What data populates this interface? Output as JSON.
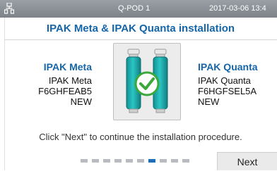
{
  "topbar": {
    "device_name": "Q-POD 1",
    "clock": "2017-03-06  13:4",
    "network_icon": "network-icon"
  },
  "page": {
    "title": "IPAK Meta & IPAK Quanta installation",
    "instruction": "Click \"Next\" to continue the installation procedure."
  },
  "meta": {
    "heading": "IPAK Meta",
    "name": "IPAK Meta",
    "serial": "F6GHFEAB5",
    "status": "NEW"
  },
  "quanta": {
    "heading": "IPAK Quanta",
    "name": "IPAK Quanta",
    "serial": "F6HGFSEL5A",
    "status": "NEW"
  },
  "graphic": {
    "icon": "filter-cartridges-check-icon",
    "accent_color": "#1fb5b5",
    "check_color": "#3aa83a"
  },
  "progress": {
    "total_steps": 10,
    "current_step": 7
  },
  "footer": {
    "next_label": "Next"
  },
  "colors": {
    "title": "#1565a8",
    "topbar": "#8a9096",
    "active_dot": "#1e6fb8"
  }
}
